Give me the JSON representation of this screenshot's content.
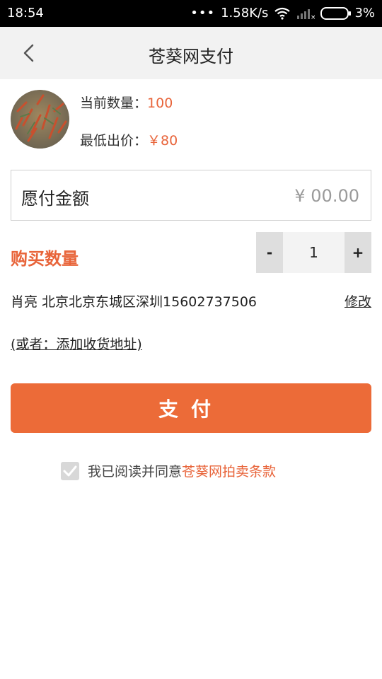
{
  "status_bar": {
    "time": "18:54",
    "network_speed": "1.58K/s",
    "battery": "3%",
    "icons": [
      "more-dots-icon",
      "wifi-icon",
      "signal-icon",
      "battery-icon"
    ]
  },
  "header": {
    "title": "苍葵网支付",
    "back_icon": "chevron-left-icon"
  },
  "product": {
    "current_qty_label": "当前数量：",
    "current_qty_value": "100",
    "min_bid_label": "最低出价：",
    "min_bid_value": "￥80"
  },
  "amount": {
    "label": "愿付金额",
    "value": "¥ 00.00"
  },
  "quantity": {
    "label": "购买数量",
    "minus": "-",
    "value": "1",
    "plus": "+"
  },
  "address": {
    "text": "肖亮 北京北京东城区深圳15602737506",
    "modify_label": "修改",
    "add_label": "(或者：添加收货地址)"
  },
  "pay_button": "支付",
  "agreement": {
    "text": "我已阅读并同意",
    "link": "苍葵网拍卖条款",
    "checked": true
  },
  "colors": {
    "accent": "#ec6b38",
    "accent_text": "#e8643a",
    "header_bg": "#f2f2f2"
  }
}
